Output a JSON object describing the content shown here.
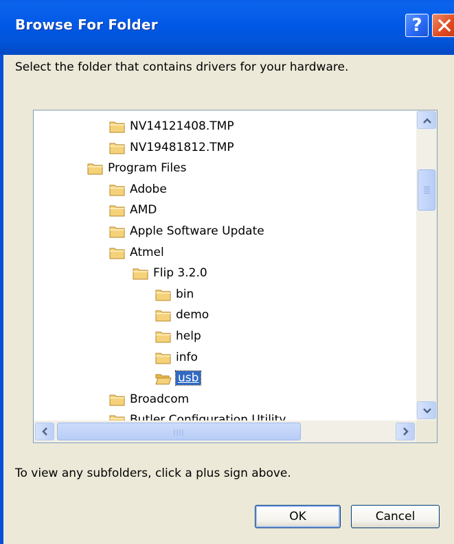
{
  "window": {
    "title": "Browse For Folder",
    "help_button": "?",
    "close_icon": "close-icon"
  },
  "instruction": "Select the folder that contains drivers for your hardware.",
  "tree": {
    "items": [
      {
        "label": "NV14121408.TMP",
        "level": 1,
        "expander": "none"
      },
      {
        "label": "NV19481812.TMP",
        "level": 1,
        "expander": "none"
      },
      {
        "label": "Program Files",
        "level": 0,
        "expander": "minus"
      },
      {
        "label": "Adobe",
        "level": 1,
        "expander": "plus"
      },
      {
        "label": "AMD",
        "level": 1,
        "expander": "plus"
      },
      {
        "label": "Apple Software Update",
        "level": 1,
        "expander": "plus"
      },
      {
        "label": "Atmel",
        "level": 1,
        "expander": "minus"
      },
      {
        "label": "Flip 3.2.0",
        "level": 2,
        "expander": "minus"
      },
      {
        "label": "bin",
        "level": 3,
        "expander": "plus"
      },
      {
        "label": "demo",
        "level": 3,
        "expander": "plus"
      },
      {
        "label": "help",
        "level": 3,
        "expander": "plus"
      },
      {
        "label": "info",
        "level": 3,
        "expander": "plus"
      },
      {
        "label": "usb",
        "level": 3,
        "expander": "none",
        "selected": true,
        "open": true
      },
      {
        "label": "Broadcom",
        "level": 1,
        "expander": "plus"
      },
      {
        "label": "Butler Configuration Utility",
        "level": 1,
        "expander": "none"
      }
    ]
  },
  "hint": "To view any subfolders, click a plus sign above.",
  "buttons": {
    "ok": "OK",
    "cancel": "Cancel"
  },
  "colors": {
    "title_bar": "#0058e6",
    "selection": "#316ac5",
    "folder": "#f5d27a",
    "dialog_bg": "#ece9d8"
  }
}
